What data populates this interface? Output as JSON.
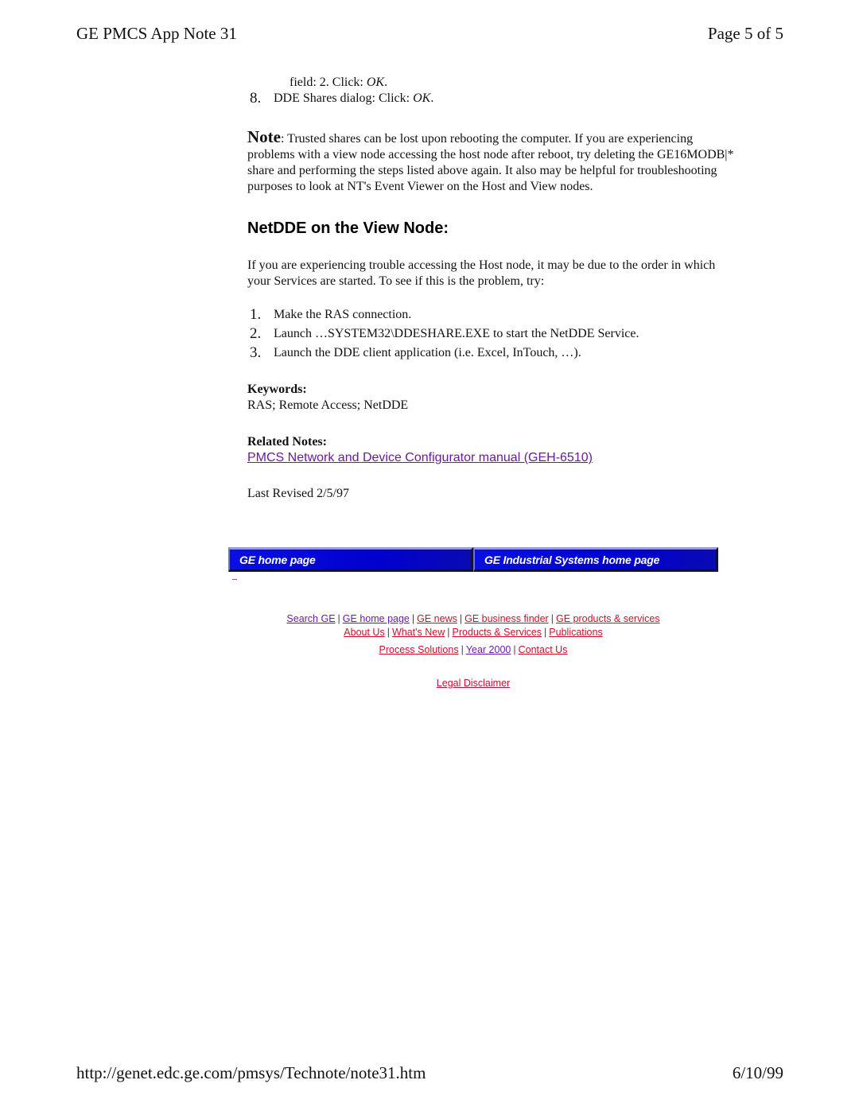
{
  "header": {
    "title": "GE PMCS App Note 31",
    "page": "Page 5 of 5"
  },
  "steps_prev": {
    "continuation": {
      "prefix": "field: 2. Click: ",
      "ok": "OK",
      "suffix": "."
    },
    "step8": {
      "num": "8.",
      "prefix": "DDE Shares dialog: Click: ",
      "ok": "OK",
      "suffix": "."
    }
  },
  "note": {
    "label": "Note",
    "text": ": Trusted shares can be lost upon rebooting the computer. If you are experiencing problems with a view node accessing the host node after reboot, try deleting the GE16MODB|* share and performing the steps listed above again. It also may be helpful for troubleshooting purposes to look at NT's Event Viewer on the Host and View nodes."
  },
  "section": {
    "heading": "NetDDE on the View Node:",
    "intro": "If you are experiencing trouble accessing the Host node, it may be due to the order in which your Services are started. To see if this is the problem, try:",
    "steps": [
      {
        "num": "1.",
        "text": "Make the RAS connection."
      },
      {
        "num": "2.",
        "text": "Launch …SYSTEM32\\DDESHARE.EXE to start the NetDDE Service."
      },
      {
        "num": "3.",
        "text": "Launch the DDE client application (i.e. Excel, InTouch, …)."
      }
    ]
  },
  "keywords": {
    "label": "Keywords:",
    "value": "RAS; Remote Access; NetDDE"
  },
  "related": {
    "label": "Related Notes:",
    "link": "PMCS Network and Device Configurator manual (GEH-6510)"
  },
  "revised": "Last Revised 2/5/97",
  "banner": {
    "ge_home": "GE home page",
    "gis_home": "GE Industrial Systems home page"
  },
  "footer_links": {
    "row1": [
      "Search GE",
      "GE home page",
      "GE news",
      "GE business finder",
      "GE products & services"
    ],
    "row2": [
      "About Us",
      "What's New",
      "Products & Services",
      "Publications"
    ],
    "row3": [
      "Process Solutions",
      "Year 2000",
      "Contact Us"
    ],
    "row4": [
      "Legal Disclaimer"
    ]
  },
  "colors": {
    "visited_link": "#6a1bb0",
    "unvisited_link": "#d0102a",
    "banner_blue": "#0000d0"
  },
  "footer": {
    "url": "http://genet.edc.ge.com/pmsys/Technote/note31.htm",
    "date": "6/10/99"
  }
}
